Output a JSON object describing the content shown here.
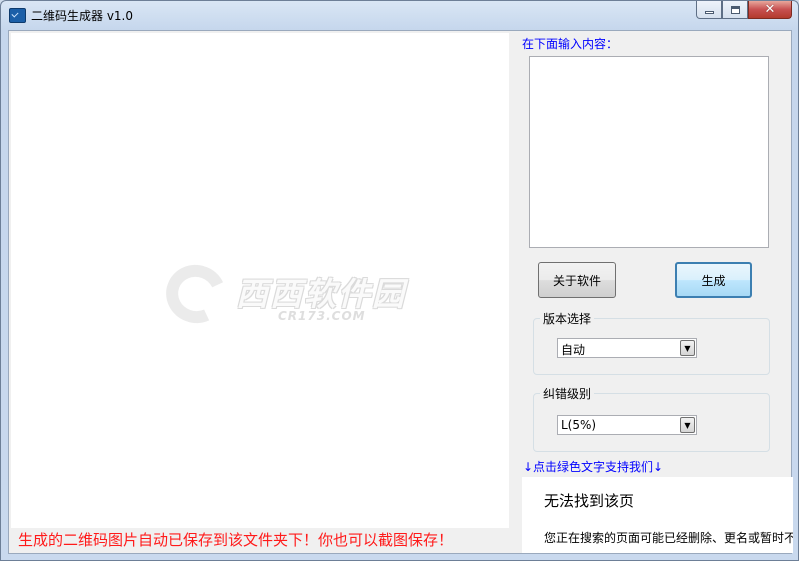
{
  "window": {
    "title": "二维码生成器 v1.0",
    "controls": {
      "close": "✕"
    }
  },
  "main": {
    "status_text": "生成的二维码图片自动已保存到该文件夹下！你也可以截图保存！",
    "watermark": {
      "text": "西西软件园",
      "sub": "CR173.COM"
    }
  },
  "side": {
    "input_label": "在下面输入内容：",
    "input_value": "",
    "about_button": "关于软件",
    "generate_button": "生成",
    "version_group": {
      "label": "版本选择",
      "selected": "自动"
    },
    "ecc_group": {
      "label": "纠错级别",
      "selected": "L(5%)"
    },
    "support_link": "↓点击绿色文字支持我们↓",
    "web_panel": {
      "title": "无法找到该页",
      "body": "您正在搜索的页面可能已经删除、更名或暂时不"
    }
  },
  "colors": {
    "status_red": "#ff1a1a",
    "link_blue": "#0000ff"
  }
}
